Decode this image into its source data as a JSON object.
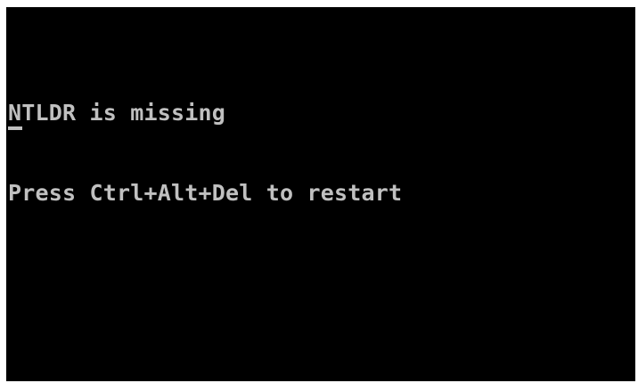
{
  "console": {
    "lines": [
      "NTLDR is missing",
      "Press Ctrl+Alt+Del to restart"
    ],
    "text_color": "#c0c0c0",
    "background_color": "#000000"
  }
}
